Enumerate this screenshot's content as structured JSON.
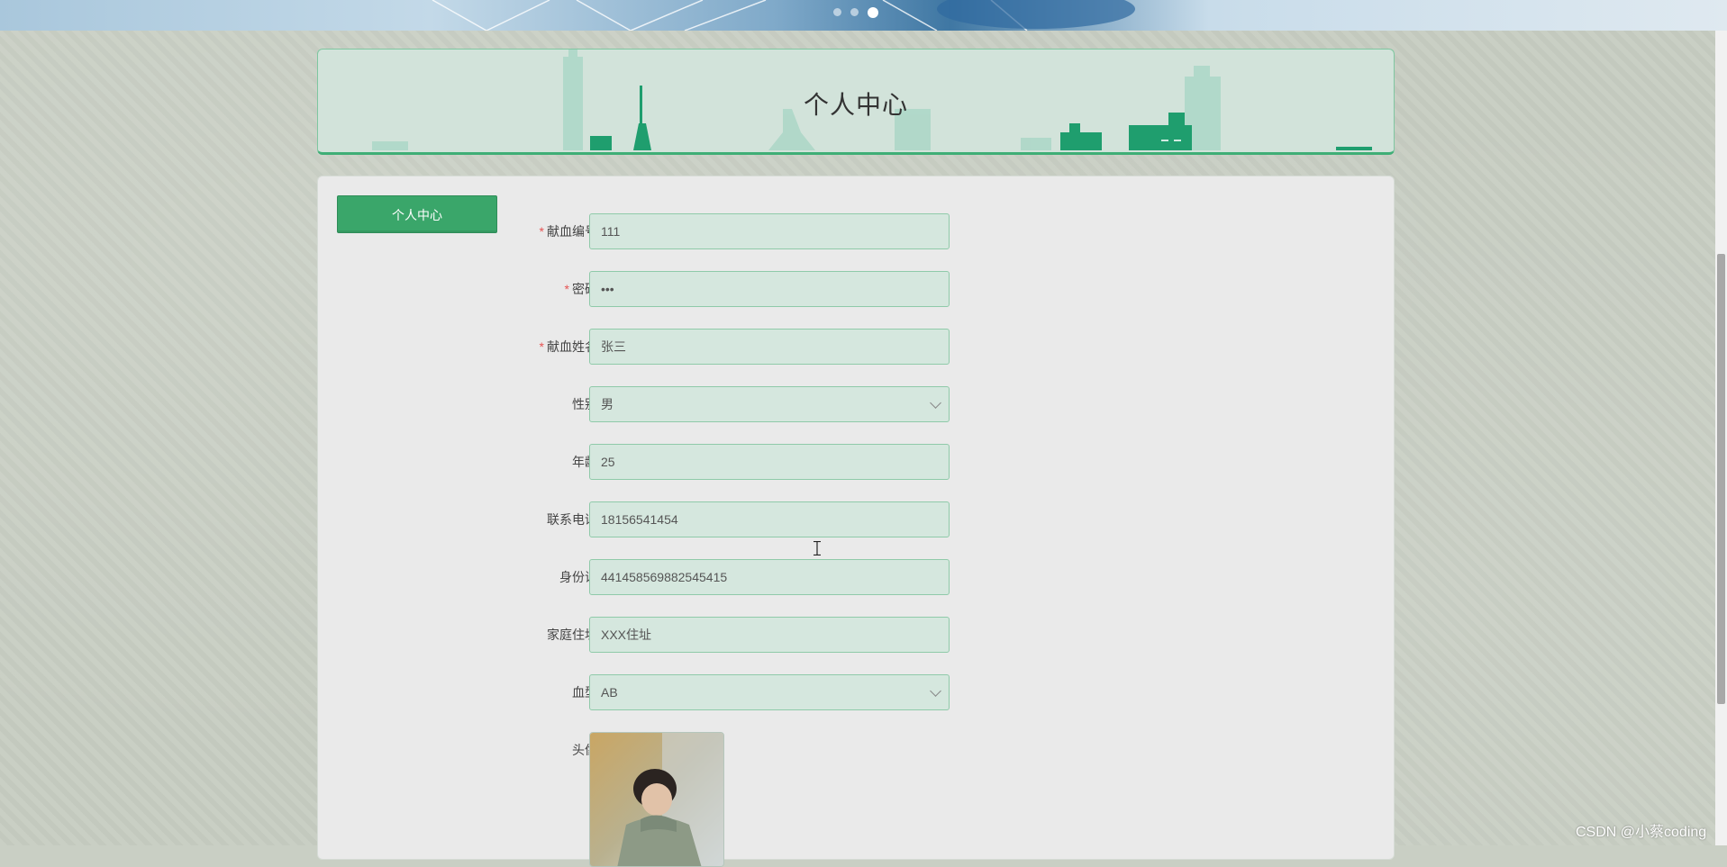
{
  "header": {
    "title": "个人中心"
  },
  "sidebar": {
    "button_label": "个人中心"
  },
  "form": {
    "fields": [
      {
        "label": "献血编号",
        "required": true,
        "value": "111",
        "type": "text"
      },
      {
        "label": "密码",
        "required": true,
        "value": "•••",
        "type": "password"
      },
      {
        "label": "献血姓名",
        "required": true,
        "value": "张三",
        "type": "text"
      },
      {
        "label": "性别",
        "required": false,
        "value": "男",
        "type": "select"
      },
      {
        "label": "年龄",
        "required": false,
        "value": "25",
        "type": "text"
      },
      {
        "label": "联系电话",
        "required": false,
        "value": "18156541454",
        "type": "text"
      },
      {
        "label": "身份证",
        "required": false,
        "value": "441458569882545415",
        "type": "text"
      },
      {
        "label": "家庭住址",
        "required": false,
        "value": "XXX住址",
        "type": "text"
      },
      {
        "label": "血型",
        "required": false,
        "value": "AB",
        "type": "select"
      }
    ],
    "avatar_label": "头像",
    "required_mark": "*"
  },
  "watermark": "CSDN @小蔡coding",
  "colors": {
    "accent": "#3aa66a",
    "field_bg": "#d5e7de",
    "field_border": "#8fcaa9",
    "required": "#e65454"
  },
  "icons": {
    "select_arrow": "chevron-down-icon",
    "cursor": "text-cursor-icon"
  }
}
